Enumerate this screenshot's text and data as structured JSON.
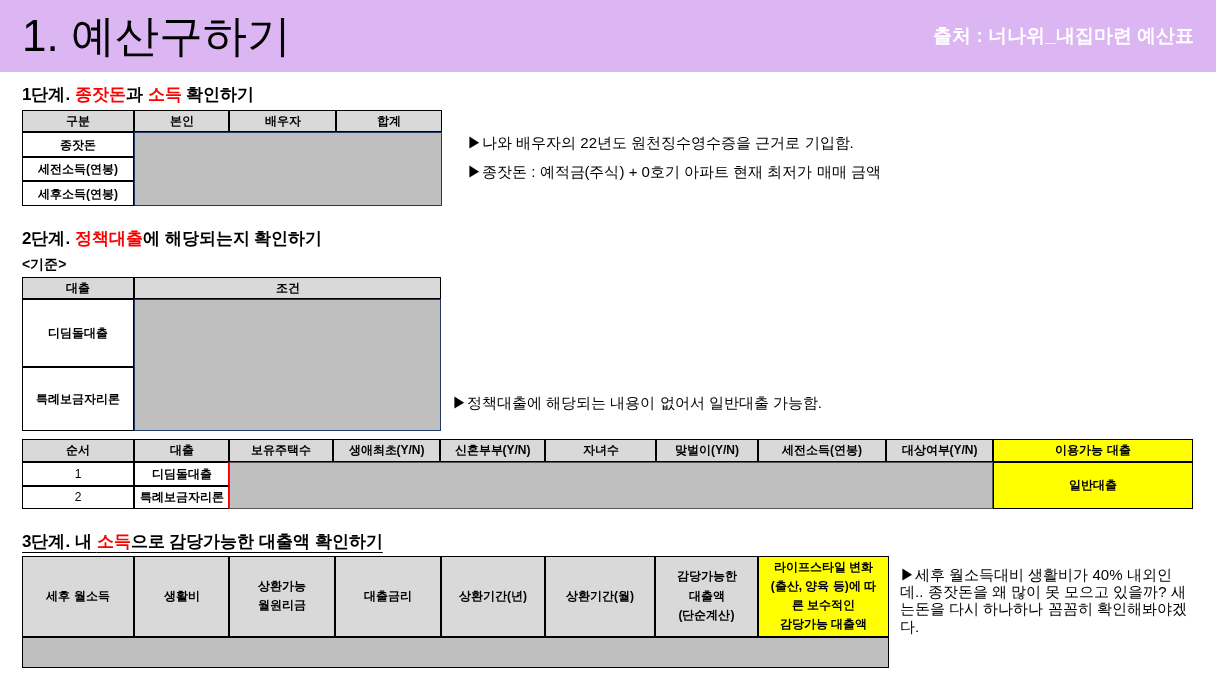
{
  "header": {
    "title": "1. 예산구하기",
    "source": "출처 : 너나위_내집마련 예산표"
  },
  "step1": {
    "heading": [
      {
        "text": "1단계. ",
        "highlight": false
      },
      {
        "text": "종잣돈",
        "highlight": true
      },
      {
        "text": "과 ",
        "highlight": false
      },
      {
        "text": "소득",
        "highlight": true
      },
      {
        "text": " 확인하기",
        "highlight": false
      }
    ],
    "columns": [
      "구분",
      "본인",
      "배우자",
      "합계"
    ],
    "rows": [
      "종잣돈",
      "세전소득(연봉)",
      "세후소득(연봉)"
    ],
    "notes": [
      "▶나와 배우자의 22년도 원천징수영수증을 근거로 기입함.",
      "▶종잣돈 : 예적금(주식) + 0호기 아파트 현재 최저가 매매 금액"
    ]
  },
  "step2": {
    "heading": [
      {
        "text": "2단계. ",
        "highlight": false
      },
      {
        "text": "정책대출",
        "highlight": true
      },
      {
        "text": "에 해당되는지 확인하기",
        "highlight": false
      }
    ],
    "subheading": "<기준>",
    "columns": [
      "대출",
      "조건"
    ],
    "rows": [
      "디딤돌대출",
      "특례보금자리론"
    ],
    "note": "▶정책대출에 해당되는 내용이 없어서 일반대출 가능함.",
    "check_table": {
      "columns": [
        "순서",
        "대출",
        "보유주택수",
        "생애최초(Y/N)",
        "신혼부부(Y/N)",
        "자녀수",
        "맞벌이(Y/N)",
        "세전소득(연봉)",
        "대상여부(Y/N)",
        "이용가능 대출"
      ],
      "rows": [
        {
          "order": "1",
          "loan": "디딤돌대출"
        },
        {
          "order": "2",
          "loan": "특례보금자리론"
        }
      ],
      "result": "일반대출"
    }
  },
  "step3": {
    "heading": [
      {
        "text": "3단계. 내 ",
        "highlight": false
      },
      {
        "text": "소득",
        "highlight": true
      },
      {
        "text": "으로 감당가능한 대출액 확인하기",
        "highlight": false
      }
    ],
    "columns": [
      {
        "label": "세후 월소득",
        "highlight": false
      },
      {
        "label": "생활비",
        "highlight": false
      },
      {
        "label": "상환가능\n월원리금",
        "highlight": false
      },
      {
        "label": "대출금리",
        "highlight": false
      },
      {
        "label": "상환기간(년)",
        "highlight": false
      },
      {
        "label": "상환기간(월)",
        "highlight": false
      },
      {
        "label": "감당가능한\n대출액\n(단순계산)",
        "highlight": false
      },
      {
        "label": "라이프스타일 변화\n(출산, 양육 등)에 따\n른 보수적인\n감당가능 대출액",
        "highlight": true
      }
    ],
    "note": "▶세후 월소득대비 생활비가 40% 내외인데.. 종잣돈을 왜 많이 못 모으고 있을까? 새는돈을 다시 하나하나 꼼꼼히 확인해봐야겠다."
  }
}
